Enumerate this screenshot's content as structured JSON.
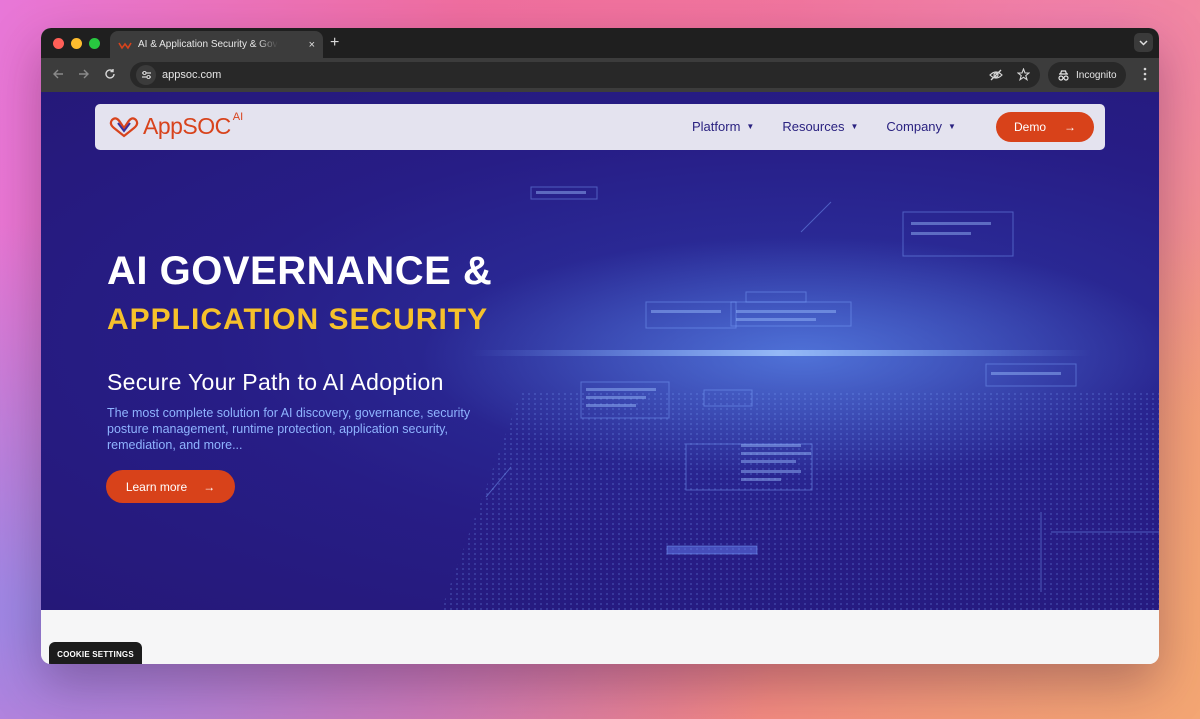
{
  "browser": {
    "tab": {
      "title": "AI & Application Security & Governance",
      "close": "×"
    },
    "new_tab": "+",
    "url": "appsoc.com",
    "incognito_label": "Incognito"
  },
  "site": {
    "logo": {
      "text": "AppSOC",
      "superscript": "AI"
    },
    "nav": [
      {
        "label": "Platform",
        "caret": "▼"
      },
      {
        "label": "Resources",
        "caret": "▼"
      },
      {
        "label": "Company",
        "caret": "▼"
      }
    ],
    "demo_button": {
      "label": "Demo",
      "arrow": "→"
    },
    "hero": {
      "title_line1": "AI GOVERNANCE &",
      "title_line2": "APPLICATION SECURITY",
      "subtitle": "Secure Your Path to AI Adoption",
      "description": "The most complete solution for AI discovery, governance, security posture management, runtime protection, application security, remediation, and more...",
      "cta": {
        "label": "Learn more",
        "arrow": "→"
      }
    },
    "cookie_settings": "COOKIE SETTINGS"
  },
  "colors": {
    "accent": "#d8421a",
    "highlight": "#f6c12b",
    "nav_text": "#2a2280",
    "hero_bg": "#271d86",
    "desc_text": "#8fb4ff"
  }
}
